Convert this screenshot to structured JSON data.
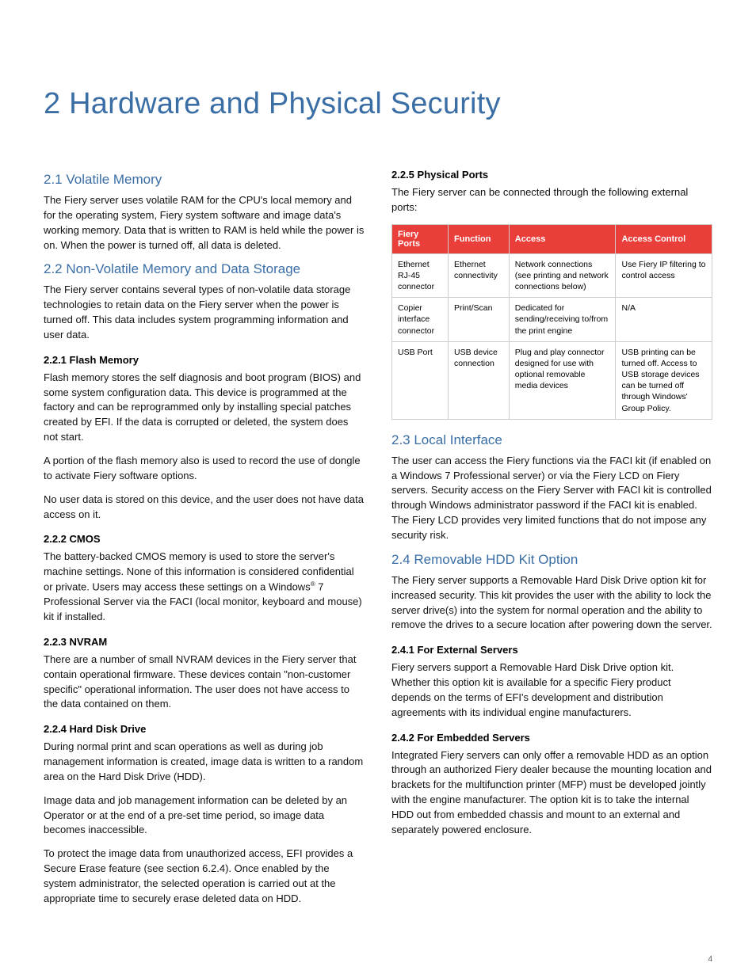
{
  "pageTitle": "2 Hardware and Physical Security",
  "pageNumber": "4",
  "left": {
    "s21_h": "2.1  Volatile Memory",
    "s21_p1": "The Fiery server uses volatile RAM for the CPU's local memory and for the operating system, Fiery system software and image data's working memory. Data that is written to RAM is held while the power is on. When the power is turned off, all data is deleted.",
    "s22_h": "2.2  Non-Volatile Memory and Data Storage",
    "s22_p1": "The Fiery server contains several types of non-volatile data storage technologies to retain data on the Fiery server when the power is turned off. This data includes system programming information and user data.",
    "s221_h": "2.2.1  Flash Memory",
    "s221_p1": "Flash memory stores the self diagnosis and boot program (BIOS) and some system configuration data. This device is programmed at the factory and can be reprogrammed only by installing special patches created by EFI. If the data is corrupted or deleted, the system does not start.",
    "s221_p2": "A portion of the flash memory also is used to record the use of dongle to activate Fiery software options.",
    "s221_p3": "No user data is stored on this device, and the user does not have data access on it.",
    "s222_h": "2.2.2  CMOS",
    "s222_p_a": "The battery-backed CMOS memory is used to store the server's machine settings. None of this information is considered confidential or private. Users may access these settings on a Windows",
    "s222_p_b": " 7 Professional Server via the FACI (local monitor, keyboard and mouse) kit if installed.",
    "s223_h": "2.2.3  NVRAM",
    "s223_p1": "There are a number of small NVRAM devices in the Fiery server that contain operational firmware. These devices contain \"non-customer specific\" operational information. The user does not have access to the data contained on them.",
    "s224_h": "2.2.4  Hard Disk Drive",
    "s224_p1": "During normal print and scan operations as well as during job management information is created, image data is written to a random area on the Hard Disk Drive (HDD).",
    "s224_p2": "Image data and job management information can be deleted by an Operator or at the end of a pre-set time period, so image data becomes inaccessible.",
    "s224_p3": "To protect the image data from unauthorized access, EFI provides a Secure Erase feature (see section 6.2.4). Once enabled by the system administrator, the selected operation is carried out at the appropriate time to securely erase deleted data on HDD."
  },
  "right": {
    "s225_h": "2.2.5  Physical Ports",
    "s225_p1": "The Fiery server can be connected through the following external ports:",
    "table": {
      "headers": [
        "Fiery Ports",
        "Function",
        "Access",
        "Access Control"
      ],
      "rows": [
        [
          "Ethernet RJ-45 connector",
          "Ethernet connectivity",
          "Network connections (see printing and network connections below)",
          "Use Fiery IP filtering to control access"
        ],
        [
          "Copier interface connector",
          "Print/Scan",
          "Dedicated for sending/receiving to/from the print engine",
          "N/A"
        ],
        [
          "USB Port",
          "USB device connection",
          "Plug and play connector designed for use with optional removable media devices",
          "USB printing can be turned off. Access to USB storage devices can be turned off through Windows' Group Policy."
        ]
      ]
    },
    "s23_h": "2.3 Local Interface",
    "s23_p1": "The user can access the Fiery functions via the FACI kit (if enabled on a Windows 7 Professional server) or via the Fiery LCD on Fiery servers. Security access on the Fiery Server with FACI kit is controlled through Windows administrator password if the FACI kit is enabled. The Fiery LCD provides very limited functions that do not impose any security risk.",
    "s24_h": "2.4  Removable HDD Kit Option",
    "s24_p1": "The Fiery server supports a Removable Hard Disk Drive option kit for increased security. This kit provides the user with the ability to lock the server drive(s) into the system for normal operation and the ability to remove the drives to a secure location after powering down the server.",
    "s241_h": "2.4.1  For External Servers",
    "s241_p1": "Fiery servers support a Removable Hard Disk Drive option kit. Whether this option kit is available for a specific Fiery product depends on the terms of EFI's development and distribution agreements with its individual engine manufacturers.",
    "s242_h": "2.4.2  For Embedded Servers",
    "s242_p1": "Integrated Fiery servers can only offer a removable HDD as an option through an authorized Fiery dealer because the mounting location and brackets for the multifunction printer (MFP) must be developed jointly with the engine manufacturer. The option kit is to take the internal HDD out from embedded chassis and mount to an external and separately powered enclosure."
  }
}
